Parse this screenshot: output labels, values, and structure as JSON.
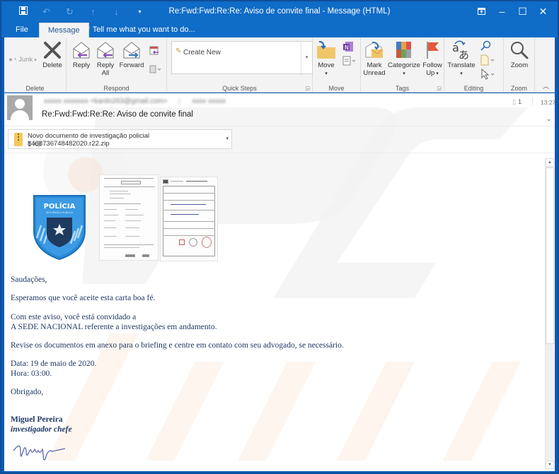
{
  "window": {
    "title": "Re:Fwd:Fwd:Re:Re: Aviso de convite final  -  Message (HTML)",
    "qat_icons": [
      "save-icon",
      "undo-icon",
      "redo-icon",
      "up-arrow-icon",
      "down-arrow-icon",
      "customize-qat-icon"
    ],
    "controls": [
      "ribbon-display-options-icon",
      "minimize-icon",
      "maximize-icon",
      "close-icon"
    ]
  },
  "tabs": [
    {
      "label": "File",
      "active": false
    },
    {
      "label": "Message",
      "active": true
    }
  ],
  "tell_me": {
    "placeholder": "Tell me what you want to do..."
  },
  "ribbon": {
    "groups": {
      "delete": "Delete",
      "respond": "Respond",
      "quick_steps": "Quick Steps",
      "move": "Move",
      "tags": "Tags",
      "editing": "Editing",
      "zoom": "Zoom"
    },
    "buttons": {
      "junk": "Junk",
      "delete": "Delete",
      "reply": "Reply",
      "reply_all_1": "Reply",
      "reply_all_2": "All",
      "forward": "Forward",
      "create_new": "Create New",
      "move": "Move",
      "mark_unread_1": "Mark",
      "mark_unread_2": "Unread",
      "categorize": "Categorize",
      "follow_up_1": "Follow",
      "follow_up_2": "Up",
      "translate": "Translate",
      "zoom": "Zoom"
    }
  },
  "message": {
    "sender_name": "xxxxx xxxxxxx",
    "sender_email": "<kardo263@gmail.com>",
    "recipient": "xxxx xxxxx",
    "subject": "Re:Fwd:Fwd:Re:Re: Aviso de convite final",
    "attachment_count": "1",
    "time": "13:27",
    "attachment": {
      "name": "Novo documento de investigação policial 8468736748482020.r22.zip",
      "size": "1 KB"
    },
    "logo_text": "POLÍCIA",
    "logo_subtext": "SEGURANÇA PÚBLICA",
    "body": {
      "greeting": "Saudações,",
      "p1": "Esperamos que você aceite esta carta boa fé.",
      "p2_line1": "Com este aviso, você está convidado a",
      "p2_line2": "A SEDE NACIONAL referente a investigações em andamento.",
      "p3": "Revise os documentos em anexo para o briefing e centre em contato com seu advogado, se necessário.",
      "date": "Data: 19 de maio de 2020.",
      "hour": "Hora: 03:00.",
      "thanks": "Obrigado,",
      "sig_name": "Miguel  Pereira",
      "sig_title": "investigador chefe"
    }
  },
  "colors": {
    "title_bar": "#0f6cc7",
    "ribbon_bg": "#f3f3f3",
    "body_text": "#1f3864",
    "badge_blue": "#2a8ad6"
  }
}
